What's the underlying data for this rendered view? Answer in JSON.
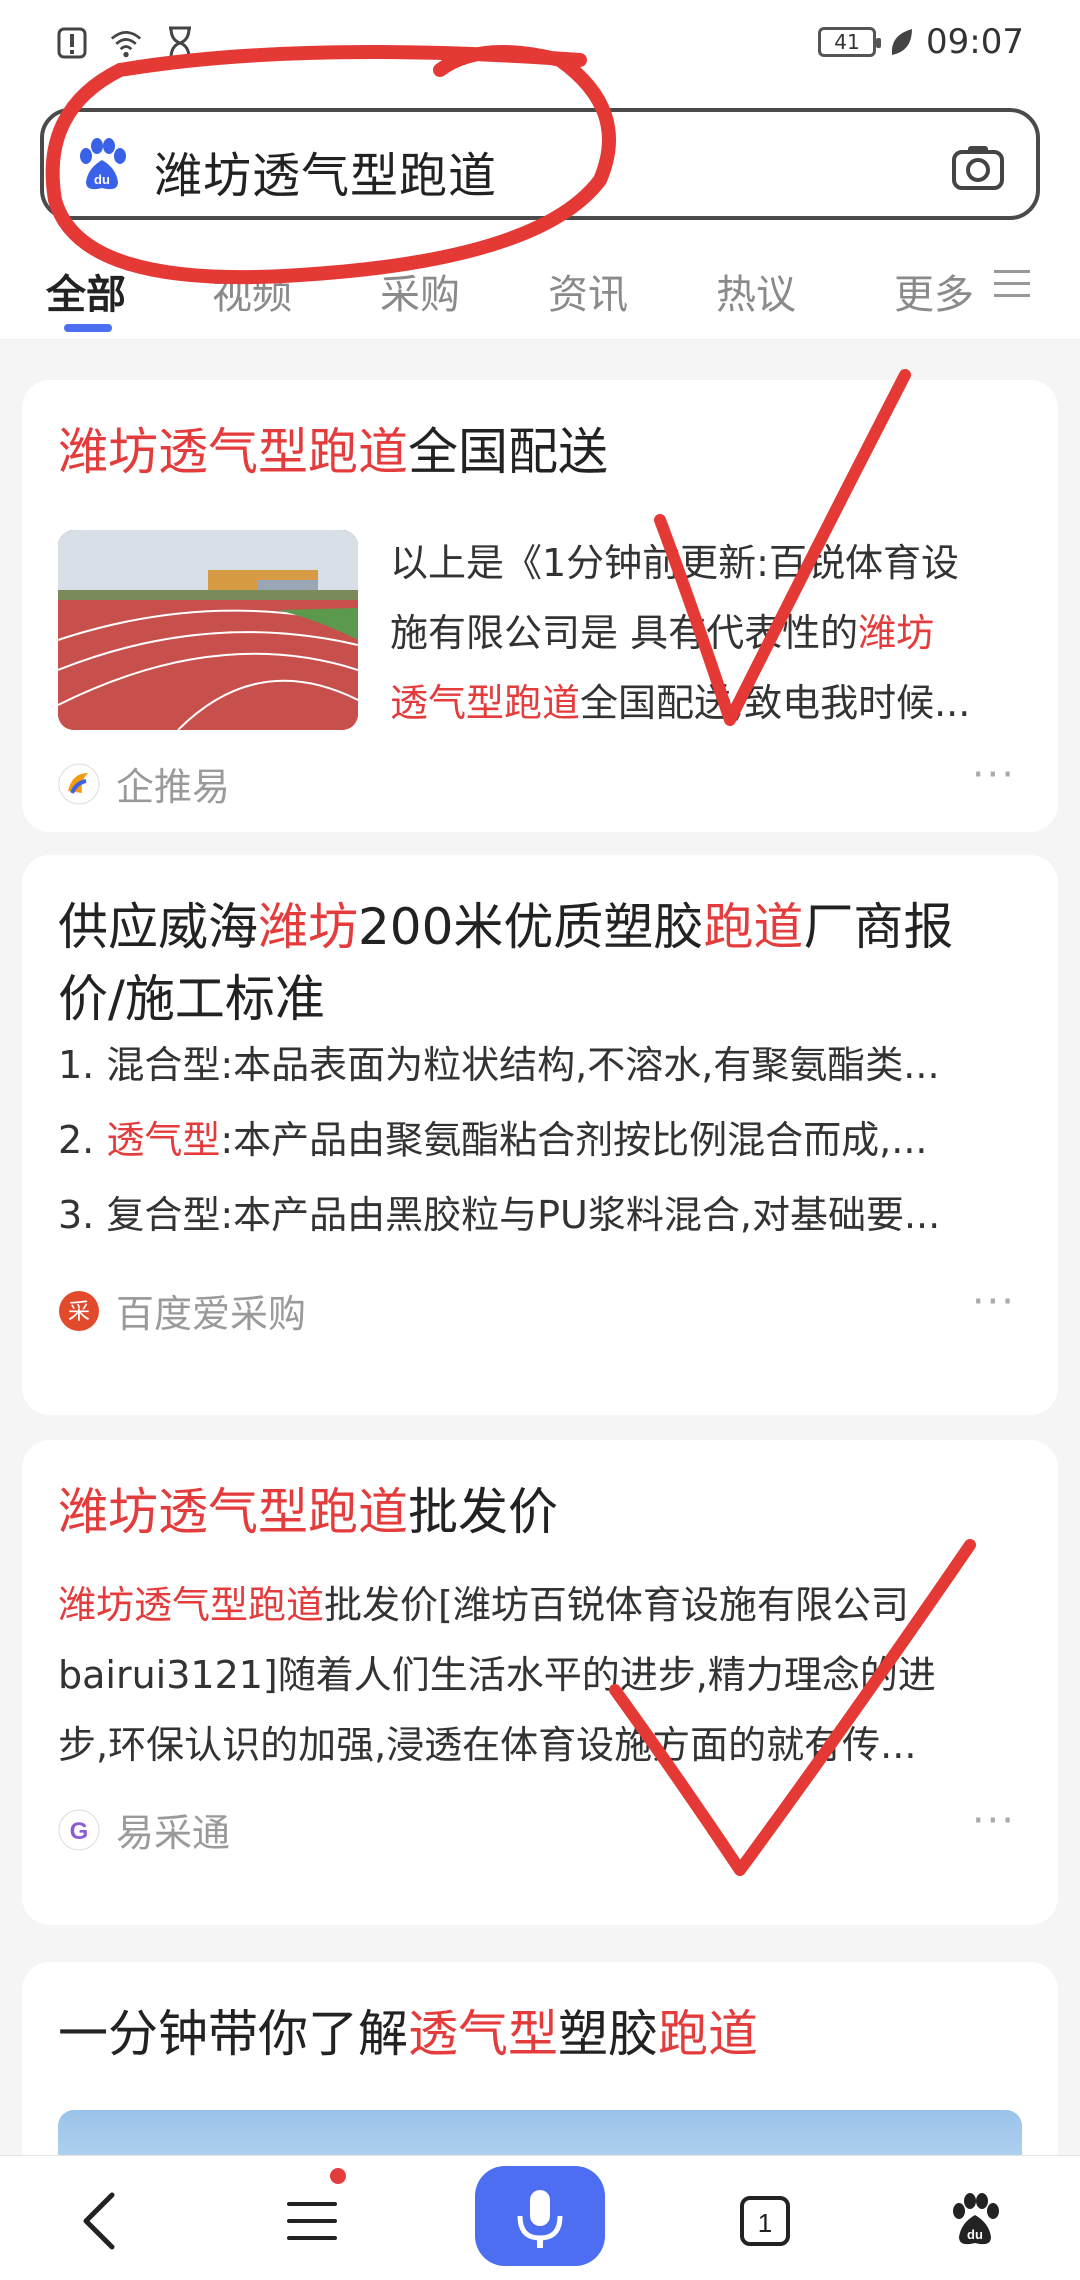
{
  "status_bar": {
    "time": "09:07",
    "battery": "41"
  },
  "search": {
    "query": "潍坊透气型跑道"
  },
  "tabs": [
    {
      "label": "全部"
    },
    {
      "label": "视频"
    },
    {
      "label": "采购"
    },
    {
      "label": "资讯"
    },
    {
      "label": "热议"
    },
    {
      "label": "更多"
    }
  ],
  "results": [
    {
      "title_hl": "潍坊透气型跑道",
      "title_rest": "全国配送",
      "snippet_line1": "以上是《1分钟前更新:百锐体育设",
      "snippet_line2a": "施有限公司是 具有代表性的",
      "snippet_line2b": "潍坊",
      "snippet_line3a": "透气型跑道",
      "snippet_line3b": "全国配送,致电我时候...",
      "source": "企推易",
      "more": "···"
    },
    {
      "title_a": "供应威海",
      "title_b": "潍坊",
      "title_c": "200米优质塑胶",
      "title_d": "跑道",
      "title_e": "厂商报",
      "title_line2": "价/施工标准",
      "line1": "1. 混合型:本品表面为粒状结构,不溶水,有聚氨酯类...",
      "line2_prefix": "2. ",
      "line2_hl": "透气型",
      "line2_rest": ":本产品由聚氨酯粘合剂按比例混合而成,...",
      "line3": "3. 复合型:本产品由黑胶粒与PU浆料混合,对基础要...",
      "source": "百度爱采购",
      "more": "···"
    },
    {
      "title_hl": "潍坊透气型跑道",
      "title_rest": "批发价",
      "line1_hl": "潍坊透气型跑道",
      "line1_rest": "批发价[潍坊百锐体育设施有限公司",
      "line2": "bairui3121]随着人们生活水平的进步,精力理念的进",
      "line3": "步,环保认识的加强,浸透在体育设施方面的就有传...",
      "source": "易采通",
      "more": "···"
    },
    {
      "title_a": "一分钟带你了解",
      "title_b": "透气型",
      "title_c": "塑胶",
      "title_d": "跑道"
    }
  ],
  "bottom_nav": {
    "tab_count": "1"
  },
  "colors": {
    "accent": "#4e6ef2",
    "highlight": "#e43c3c",
    "annotation": "#e53935"
  }
}
